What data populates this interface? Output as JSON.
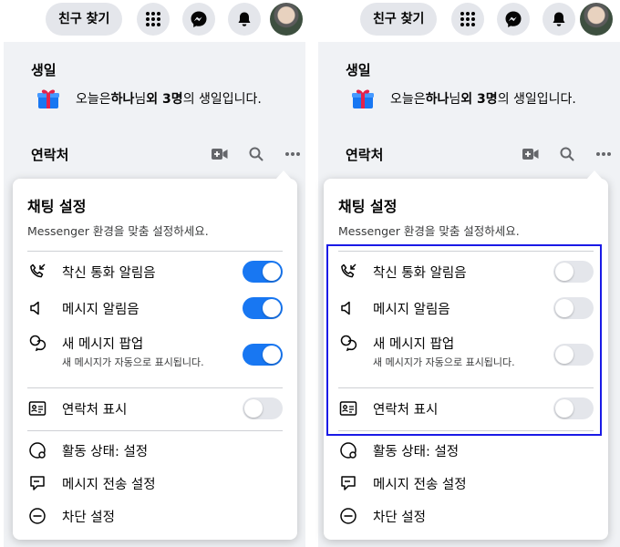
{
  "topbar": {
    "find_friends_label": "친구 찾기",
    "menu_icon": "grid-menu-icon",
    "messenger_icon": "messenger-icon",
    "notification_icon": "bell-icon",
    "avatar_icon": "profile-avatar"
  },
  "birthday": {
    "title": "생일",
    "prefix": "오늘은 ",
    "name": "하나",
    "mid": "님 ",
    "count": "외 3명",
    "suffix": "의 생일입니다."
  },
  "contacts": {
    "title": "연락처"
  },
  "chat_settings": {
    "title": "채팅 설정",
    "subtitle": "Messenger 환경을 맞춤 설정하세요.",
    "incoming_call_label": "착신 통화 알림음",
    "message_sound_label": "메시지 알림음",
    "new_message_popup_label": "새 메시지 팝업",
    "new_message_popup_note": "새 메시지가 자동으로 표시됩니다.",
    "show_contacts_label": "연락처 표시",
    "active_status_label": "활동 상태: 설정",
    "message_delivery_label": "메시지 전송 설정",
    "block_settings_label": "차단 설정"
  },
  "panels": [
    {
      "incoming_call_on": true,
      "message_sound_on": true,
      "new_message_popup_on": true,
      "show_contacts_on": false
    },
    {
      "incoming_call_on": false,
      "message_sound_on": false,
      "new_message_popup_on": false,
      "show_contacts_on": false
    }
  ],
  "colors": {
    "toggle_on": "#1877f2",
    "toggle_off": "#e4e6eb",
    "highlight_box": "#1a1ae6",
    "background_gray": "#f0f2f5"
  }
}
